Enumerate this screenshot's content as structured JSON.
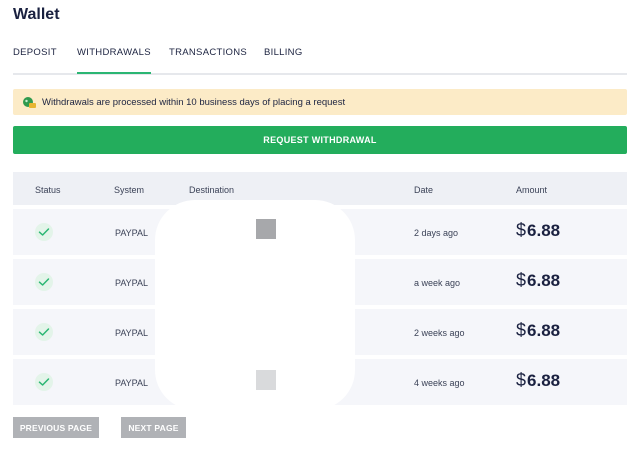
{
  "page": {
    "title": "Wallet"
  },
  "tabs": [
    {
      "label": "DEPOSIT",
      "active": false
    },
    {
      "label": "WITHDRAWALS",
      "active": true
    },
    {
      "label": "TRANSACTIONS",
      "active": false
    },
    {
      "label": "BILLING",
      "active": false
    }
  ],
  "notice": {
    "icon": "money-bag-icon",
    "text": "Withdrawals are processed within 10 business days of placing a request"
  },
  "request_button": {
    "label": "REQUEST WITHDRAWAL"
  },
  "table": {
    "headers": [
      "Status",
      "System",
      "Destination",
      "Date",
      "Amount"
    ],
    "rows": [
      {
        "status": "check-icon",
        "system": "PAYPAL",
        "date": "2 days ago",
        "currency": "$",
        "amount": "6.88"
      },
      {
        "status": "check-icon",
        "system": "PAYPAL",
        "date": "a week ago",
        "currency": "$",
        "amount": "6.88"
      },
      {
        "status": "check-icon",
        "system": "PAYPAL",
        "date": "2 weeks ago",
        "currency": "$",
        "amount": "6.88"
      },
      {
        "status": "check-icon",
        "system": "PAYPAL",
        "date": "4 weeks ago",
        "currency": "$",
        "amount": "6.88"
      }
    ]
  },
  "pagination": {
    "previous_label": "PREVIOUS PAGE",
    "next_label": "NEXT PAGE"
  },
  "colors": {
    "accent": "#23ad5c",
    "notice_bg": "#fcebc7",
    "disabled": "#b0b2b6"
  }
}
